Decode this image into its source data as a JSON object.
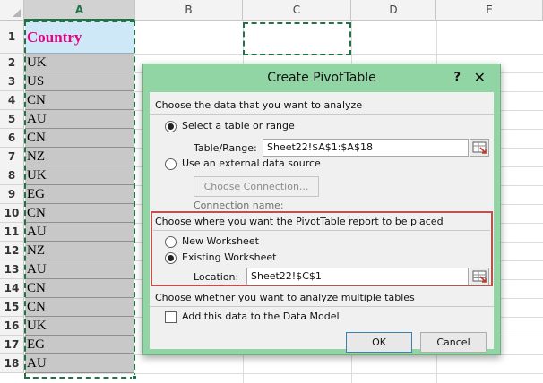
{
  "sheet": {
    "columns": [
      "A",
      "B",
      "C",
      "D",
      "E"
    ],
    "rows": [
      "1",
      "2",
      "3",
      "4",
      "5",
      "6",
      "7",
      "8",
      "9",
      "10",
      "11",
      "12",
      "13",
      "14",
      "15",
      "16",
      "17",
      "18"
    ],
    "header_cell": "Country",
    "values": [
      "UK",
      "US",
      "CN",
      "AU",
      "CN",
      "NZ",
      "UK",
      "EG",
      "CN",
      "AU",
      "NZ",
      "AU",
      "CN",
      "CN",
      "UK",
      "EG",
      "AU"
    ]
  },
  "dialog": {
    "title": "Create PivotTable",
    "help": "?",
    "close": "✕",
    "section_analyze": "Choose the data that you want to analyze",
    "opt_table": "Select a table or range",
    "table_range_label": "Table/Range:",
    "table_range_value": "Sheet22!$A$1:$A$18",
    "opt_external": "Use an external data source",
    "choose_connection": "Choose Connection...",
    "connection_name_label": "Connection name:",
    "section_place": "Choose where you want the PivotTable report to be placed",
    "opt_new": "New Worksheet",
    "opt_existing": "Existing Worksheet",
    "location_label": "Location:",
    "location_value": "Sheet22!$C$1",
    "section_multi": "Choose whether you want to analyze multiple tables",
    "data_model": "Add this data to the Data Model",
    "ok": "OK",
    "cancel": "Cancel"
  }
}
